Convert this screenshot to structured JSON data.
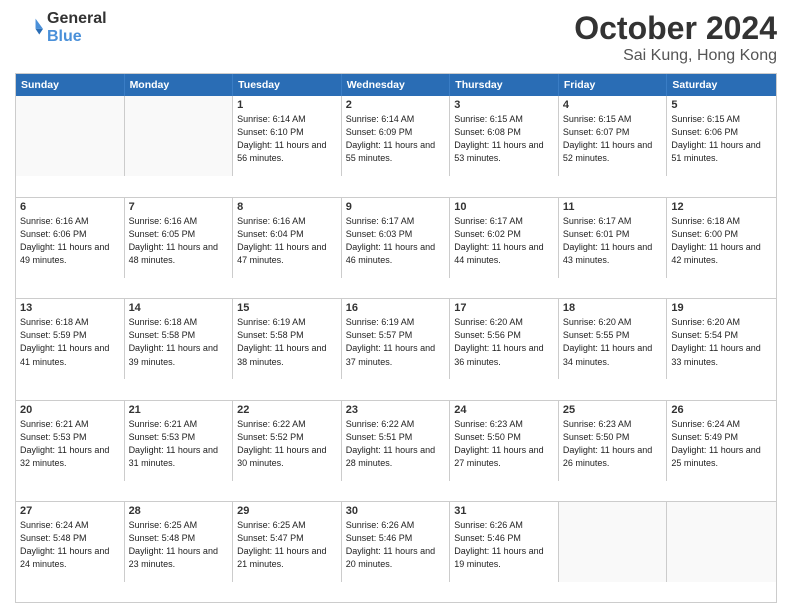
{
  "logo": {
    "general": "General",
    "blue": "Blue"
  },
  "header": {
    "month": "October 2024",
    "location": "Sai Kung, Hong Kong"
  },
  "days_of_week": [
    "Sunday",
    "Monday",
    "Tuesday",
    "Wednesday",
    "Thursday",
    "Friday",
    "Saturday"
  ],
  "weeks": [
    [
      {
        "day": "",
        "empty": true
      },
      {
        "day": "",
        "empty": true
      },
      {
        "day": "1",
        "sunrise": "6:14 AM",
        "sunset": "6:10 PM",
        "daylight": "11 hours and 56 minutes."
      },
      {
        "day": "2",
        "sunrise": "6:14 AM",
        "sunset": "6:09 PM",
        "daylight": "11 hours and 55 minutes."
      },
      {
        "day": "3",
        "sunrise": "6:15 AM",
        "sunset": "6:08 PM",
        "daylight": "11 hours and 53 minutes."
      },
      {
        "day": "4",
        "sunrise": "6:15 AM",
        "sunset": "6:07 PM",
        "daylight": "11 hours and 52 minutes."
      },
      {
        "day": "5",
        "sunrise": "6:15 AM",
        "sunset": "6:06 PM",
        "daylight": "11 hours and 51 minutes."
      }
    ],
    [
      {
        "day": "6",
        "sunrise": "6:16 AM",
        "sunset": "6:06 PM",
        "daylight": "11 hours and 49 minutes."
      },
      {
        "day": "7",
        "sunrise": "6:16 AM",
        "sunset": "6:05 PM",
        "daylight": "11 hours and 48 minutes."
      },
      {
        "day": "8",
        "sunrise": "6:16 AM",
        "sunset": "6:04 PM",
        "daylight": "11 hours and 47 minutes."
      },
      {
        "day": "9",
        "sunrise": "6:17 AM",
        "sunset": "6:03 PM",
        "daylight": "11 hours and 46 minutes."
      },
      {
        "day": "10",
        "sunrise": "6:17 AM",
        "sunset": "6:02 PM",
        "daylight": "11 hours and 44 minutes."
      },
      {
        "day": "11",
        "sunrise": "6:17 AM",
        "sunset": "6:01 PM",
        "daylight": "11 hours and 43 minutes."
      },
      {
        "day": "12",
        "sunrise": "6:18 AM",
        "sunset": "6:00 PM",
        "daylight": "11 hours and 42 minutes."
      }
    ],
    [
      {
        "day": "13",
        "sunrise": "6:18 AM",
        "sunset": "5:59 PM",
        "daylight": "11 hours and 41 minutes."
      },
      {
        "day": "14",
        "sunrise": "6:18 AM",
        "sunset": "5:58 PM",
        "daylight": "11 hours and 39 minutes."
      },
      {
        "day": "15",
        "sunrise": "6:19 AM",
        "sunset": "5:58 PM",
        "daylight": "11 hours and 38 minutes."
      },
      {
        "day": "16",
        "sunrise": "6:19 AM",
        "sunset": "5:57 PM",
        "daylight": "11 hours and 37 minutes."
      },
      {
        "day": "17",
        "sunrise": "6:20 AM",
        "sunset": "5:56 PM",
        "daylight": "11 hours and 36 minutes."
      },
      {
        "day": "18",
        "sunrise": "6:20 AM",
        "sunset": "5:55 PM",
        "daylight": "11 hours and 34 minutes."
      },
      {
        "day": "19",
        "sunrise": "6:20 AM",
        "sunset": "5:54 PM",
        "daylight": "11 hours and 33 minutes."
      }
    ],
    [
      {
        "day": "20",
        "sunrise": "6:21 AM",
        "sunset": "5:53 PM",
        "daylight": "11 hours and 32 minutes."
      },
      {
        "day": "21",
        "sunrise": "6:21 AM",
        "sunset": "5:53 PM",
        "daylight": "11 hours and 31 minutes."
      },
      {
        "day": "22",
        "sunrise": "6:22 AM",
        "sunset": "5:52 PM",
        "daylight": "11 hours and 30 minutes."
      },
      {
        "day": "23",
        "sunrise": "6:22 AM",
        "sunset": "5:51 PM",
        "daylight": "11 hours and 28 minutes."
      },
      {
        "day": "24",
        "sunrise": "6:23 AM",
        "sunset": "5:50 PM",
        "daylight": "11 hours and 27 minutes."
      },
      {
        "day": "25",
        "sunrise": "6:23 AM",
        "sunset": "5:50 PM",
        "daylight": "11 hours and 26 minutes."
      },
      {
        "day": "26",
        "sunrise": "6:24 AM",
        "sunset": "5:49 PM",
        "daylight": "11 hours and 25 minutes."
      }
    ],
    [
      {
        "day": "27",
        "sunrise": "6:24 AM",
        "sunset": "5:48 PM",
        "daylight": "11 hours and 24 minutes."
      },
      {
        "day": "28",
        "sunrise": "6:25 AM",
        "sunset": "5:48 PM",
        "daylight": "11 hours and 23 minutes."
      },
      {
        "day": "29",
        "sunrise": "6:25 AM",
        "sunset": "5:47 PM",
        "daylight": "11 hours and 21 minutes."
      },
      {
        "day": "30",
        "sunrise": "6:26 AM",
        "sunset": "5:46 PM",
        "daylight": "11 hours and 20 minutes."
      },
      {
        "day": "31",
        "sunrise": "6:26 AM",
        "sunset": "5:46 PM",
        "daylight": "11 hours and 19 minutes."
      },
      {
        "day": "",
        "empty": true
      },
      {
        "day": "",
        "empty": true
      }
    ]
  ],
  "labels": {
    "sunrise": "Sunrise:",
    "sunset": "Sunset:",
    "daylight": "Daylight:"
  }
}
